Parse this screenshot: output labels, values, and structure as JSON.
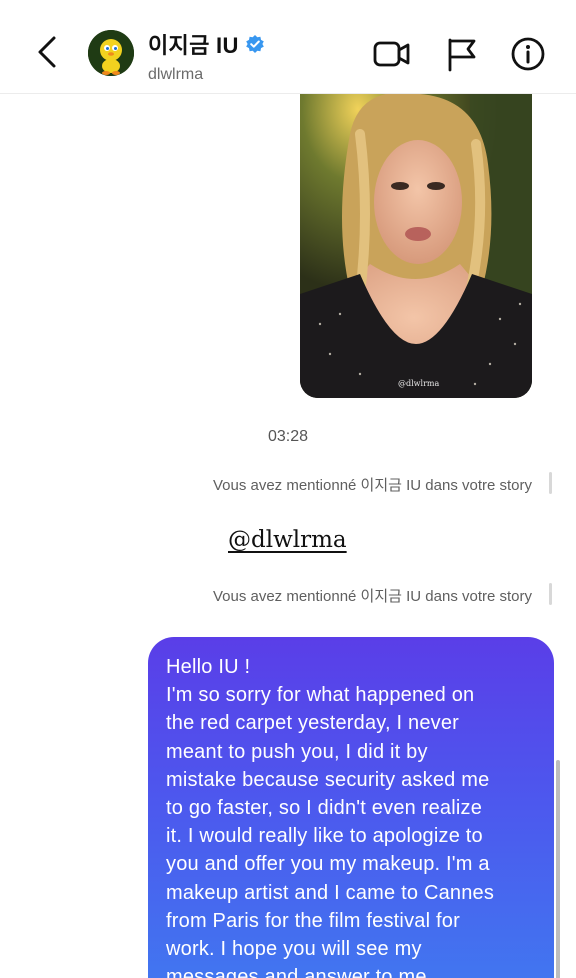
{
  "header": {
    "title": "이지금 IU",
    "username": "dlwlrma",
    "verified_color": "#3897f0",
    "icons": [
      "back-arrow-icon",
      "video-call-icon",
      "flag-icon",
      "info-icon"
    ]
  },
  "story": {
    "tag": "@dlwlrma"
  },
  "timestamp": "03:28",
  "mentions": [
    "Vous avez mentionné 이지금 IU dans votre story",
    "Vous avez mentionné 이지금 IU dans votre story"
  ],
  "mention_tag": "@dlwlrma",
  "message": {
    "text": "Hello IU !\nI'm so sorry for what happened on\nthe red carpet yesterday, I never\nmeant to push you, I did it by\nmistake because security asked me\nto go faster, so I didn't even realize\nit. I would really like to apologize to\nyou and offer you my makeup. I'm a\nmakeup artist and I came to Cannes\nfrom Paris for the film festival for\nwork. I hope you will see my\nmessages and answer to me",
    "bubble_colors": [
      "#5a3ee8",
      "#4c59ee",
      "#3f7cf0"
    ]
  }
}
